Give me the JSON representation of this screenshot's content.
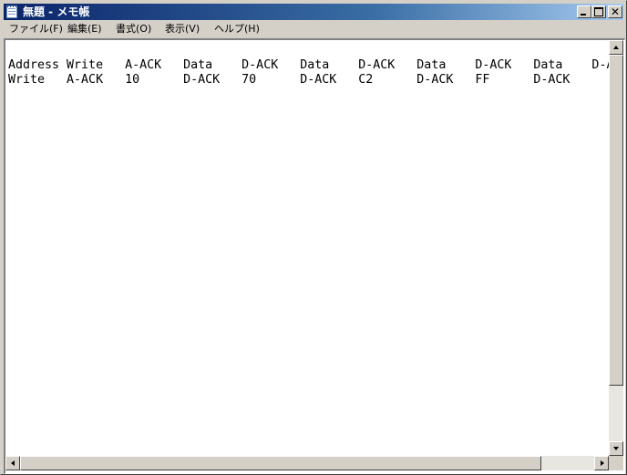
{
  "window": {
    "title": "無題 - メモ帳",
    "icon": "notepad-icon",
    "buttons": {
      "minimize": "minimize-icon",
      "maximize": "maximize-icon",
      "close": "close-icon"
    }
  },
  "menubar": {
    "items": [
      {
        "label": "ファイル(F)"
      },
      {
        "label": "編集(E)"
      },
      {
        "label": "書式(O)"
      },
      {
        "label": "表示(V)"
      },
      {
        "label": "ヘルプ(H)"
      }
    ]
  },
  "editor": {
    "lines": [
      "Address Write   A-ACK   Data    D-ACK   Data    D-ACK   Data    D-ACK   Data    D-ACK",
      "Write   A-ACK   10      D-ACK   70      D-ACK   C2      D-ACK   FF      D-ACK"
    ]
  },
  "scrollbars": {
    "vertical": {
      "position": 0
    },
    "horizontal": {
      "position": 0
    }
  }
}
